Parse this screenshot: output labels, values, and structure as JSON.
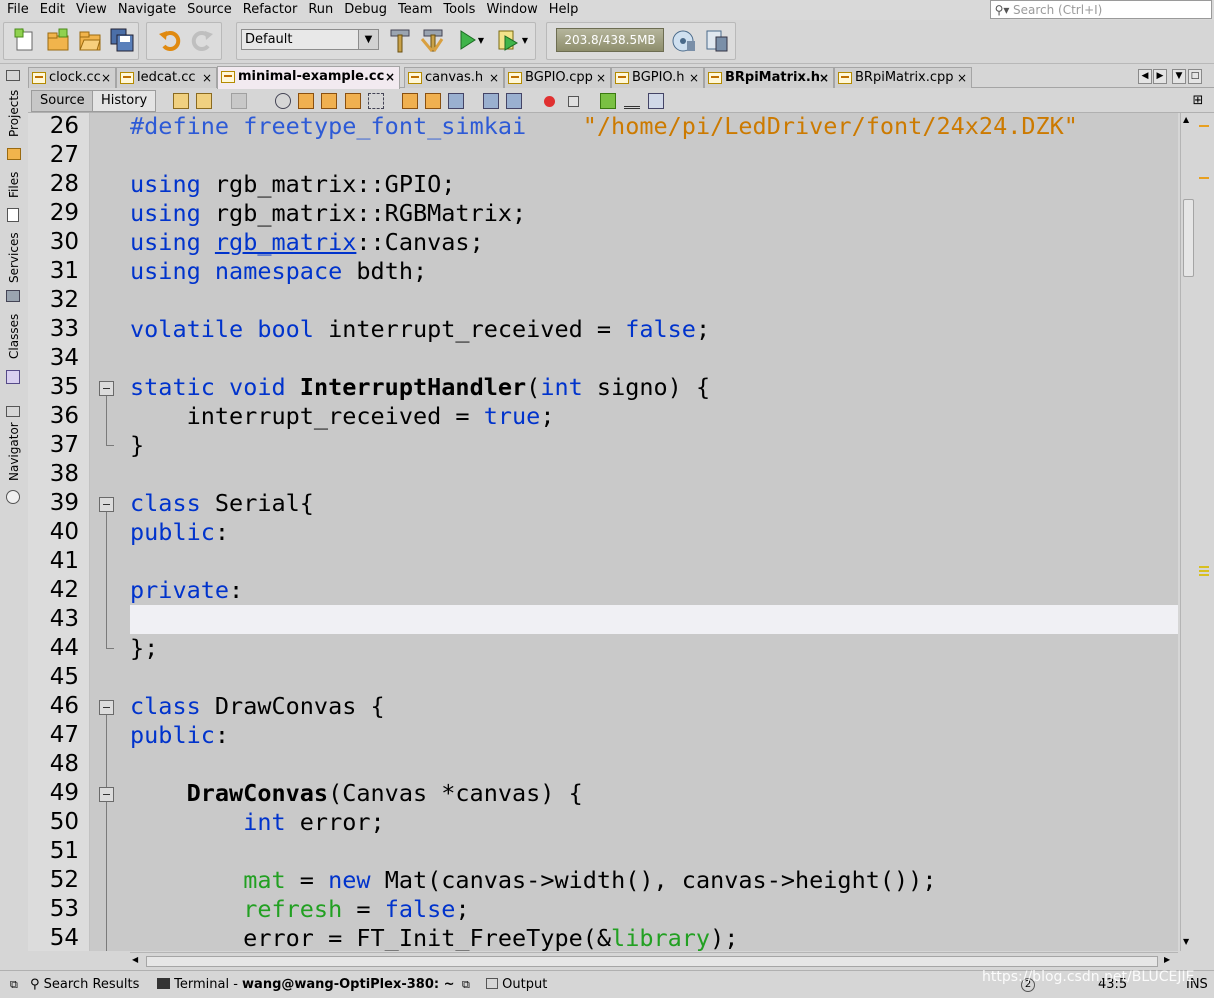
{
  "menu": [
    "File",
    "Edit",
    "View",
    "Navigate",
    "Source",
    "Refactor",
    "Run",
    "Debug",
    "Team",
    "Tools",
    "Window",
    "Help"
  ],
  "search": {
    "placeholder": "Search (Ctrl+I)"
  },
  "toolbar": {
    "config": "Default",
    "memory": "203.8/438.5MB"
  },
  "sidebar": [
    "Projects",
    "Files",
    "Services",
    "Classes",
    "Navigator"
  ],
  "tabs": [
    {
      "label": "clock.cc"
    },
    {
      "label": "ledcat.cc"
    },
    {
      "label": "minimal-example.cc"
    },
    {
      "label": "canvas.h"
    },
    {
      "label": "BGPIO.cpp"
    },
    {
      "label": "BGPIO.h"
    },
    {
      "label": "BRpiMatrix.h"
    },
    {
      "label": "BRpiMatrix.cpp"
    }
  ],
  "editor_tabs": {
    "source": "Source",
    "history": "History"
  },
  "code": {
    "lines": [
      {
        "n": "26",
        "parts": [
          [
            "mac",
            "#define"
          ],
          [
            "p",
            " "
          ],
          [
            "mac",
            "freetype_font_simkai"
          ],
          [
            "p",
            "    "
          ],
          [
            "str",
            "\"/home/pi/LedDriver/font/24x24.DZK\""
          ]
        ]
      },
      {
        "n": "27",
        "parts": []
      },
      {
        "n": "28",
        "parts": [
          [
            "kw",
            "using"
          ],
          [
            "p",
            " rgb_matrix::GPIO;"
          ]
        ]
      },
      {
        "n": "29",
        "parts": [
          [
            "kw",
            "using"
          ],
          [
            "p",
            " rgb_matrix::RGBMatrix;"
          ]
        ]
      },
      {
        "n": "30",
        "parts": [
          [
            "kw",
            "using"
          ],
          [
            "p",
            " "
          ],
          [
            "kwul",
            "rgb_matrix"
          ],
          [
            "p",
            "::Canvas;"
          ]
        ]
      },
      {
        "n": "31",
        "parts": [
          [
            "kw",
            "using"
          ],
          [
            "p",
            " "
          ],
          [
            "kw",
            "namespace"
          ],
          [
            "p",
            " bdth;"
          ]
        ]
      },
      {
        "n": "32",
        "parts": []
      },
      {
        "n": "33",
        "parts": [
          [
            "kw",
            "volatile"
          ],
          [
            "p",
            " "
          ],
          [
            "kw",
            "bool"
          ],
          [
            "p",
            " interrupt_received = "
          ],
          [
            "kw",
            "false"
          ],
          [
            "p",
            ";"
          ]
        ]
      },
      {
        "n": "34",
        "parts": []
      },
      {
        "n": "35",
        "parts": [
          [
            "kw",
            "static"
          ],
          [
            "p",
            " "
          ],
          [
            "kw",
            "void"
          ],
          [
            "p",
            " "
          ],
          [
            "fn",
            "InterruptHandler"
          ],
          [
            "p",
            "("
          ],
          [
            "kw",
            "int"
          ],
          [
            "p",
            " signo) {"
          ]
        ]
      },
      {
        "n": "36",
        "parts": [
          [
            "p",
            "    interrupt_received = "
          ],
          [
            "kw",
            "true"
          ],
          [
            "p",
            ";"
          ]
        ]
      },
      {
        "n": "37",
        "parts": [
          [
            "p",
            "}"
          ]
        ]
      },
      {
        "n": "38",
        "parts": []
      },
      {
        "n": "39",
        "parts": [
          [
            "kw",
            "class"
          ],
          [
            "p",
            " Serial{"
          ]
        ]
      },
      {
        "n": "40",
        "parts": [
          [
            "kw",
            "public"
          ],
          [
            "p",
            ":"
          ]
        ]
      },
      {
        "n": "41",
        "parts": []
      },
      {
        "n": "42",
        "parts": [
          [
            "kw",
            "private"
          ],
          [
            "p",
            ":"
          ]
        ]
      },
      {
        "n": "43",
        "parts": []
      },
      {
        "n": "44",
        "parts": [
          [
            "p",
            "};"
          ]
        ]
      },
      {
        "n": "45",
        "parts": []
      },
      {
        "n": "46",
        "parts": [
          [
            "kw",
            "class"
          ],
          [
            "p",
            " DrawConvas {"
          ]
        ]
      },
      {
        "n": "47",
        "parts": [
          [
            "kw",
            "public"
          ],
          [
            "p",
            ":"
          ]
        ]
      },
      {
        "n": "48",
        "parts": []
      },
      {
        "n": "49",
        "parts": [
          [
            "p",
            "    "
          ],
          [
            "fn",
            "DrawConvas"
          ],
          [
            "p",
            "(Canvas *canvas) {"
          ]
        ]
      },
      {
        "n": "50",
        "parts": [
          [
            "p",
            "        "
          ],
          [
            "kw",
            "int"
          ],
          [
            "p",
            " error;"
          ]
        ]
      },
      {
        "n": "51",
        "parts": []
      },
      {
        "n": "52",
        "parts": [
          [
            "p",
            "        "
          ],
          [
            "fld",
            "mat"
          ],
          [
            "p",
            " = "
          ],
          [
            "kw",
            "new"
          ],
          [
            "p",
            " Mat(canvas->width(), canvas->height());"
          ]
        ]
      },
      {
        "n": "53",
        "parts": [
          [
            "p",
            "        "
          ],
          [
            "fld",
            "refresh"
          ],
          [
            "p",
            " = "
          ],
          [
            "kw",
            "false"
          ],
          [
            "p",
            ";"
          ]
        ]
      },
      {
        "n": "54",
        "parts": [
          [
            "p",
            "        error = FT_Init_FreeType(&"
          ],
          [
            "fld",
            "library"
          ],
          [
            "p",
            ");"
          ]
        ]
      }
    ]
  },
  "status": {
    "search_results": "Search Results",
    "terminal_label": "Terminal - ",
    "terminal_session": "wang@wang-OptiPlex-380: ~",
    "output": "Output",
    "notifications": "2",
    "position": "43:5",
    "mode": "INS"
  },
  "watermark": "https://blog.csdn.net/BLUCEJIE",
  "colors": {
    "keyword": "#0033cc",
    "string": "#cc7a00",
    "macro": "#2d5ad6",
    "field": "#22a022",
    "editor_bg": "#c9c9c9",
    "current_line": "#f0f0f4"
  }
}
